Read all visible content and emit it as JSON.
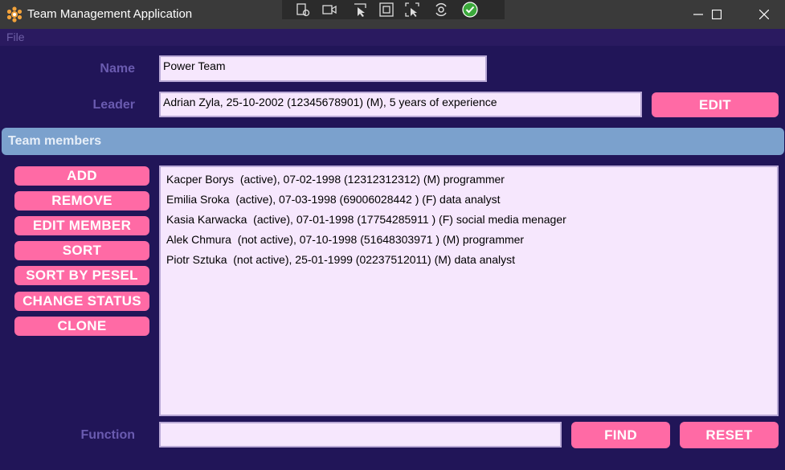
{
  "window": {
    "title": "Team Management Application"
  },
  "menu": {
    "file": "File"
  },
  "form": {
    "name_label": "Name",
    "name_value": "Power Team",
    "leader_label": "Leader",
    "leader_value": "Adrian Zyla, 25-10-2002 (12345678901) (M), 5 years of experience",
    "edit_button": "EDIT"
  },
  "section": {
    "title": "Team members"
  },
  "actions": {
    "add": "ADD",
    "remove": "REMOVE",
    "edit_member": "EDIT MEMBER",
    "sort": "SORT",
    "sort_by_pesel": "SORT BY PESEL",
    "change_status": "CHANGE STATUS",
    "clone": "CLONE"
  },
  "members": [
    "Kacper Borys  (active), 07-02-1998 (12312312312) (M) programmer",
    "Emilia Sroka  (active), 07-03-1998 (69006028442 ) (F) data analyst",
    "Kasia Karwacka  (active), 07-01-1998 (17754285911 ) (F) social media menager",
    "Alek Chmura  (not active), 07-10-1998 (51648303971 ) (M) programmer",
    "Piotr Sztuka  (not active), 25-01-1999 (02237512011) (M) data analyst"
  ],
  "search": {
    "function_label": "Function",
    "function_value": "",
    "find_button": "FIND",
    "reset_button": "RESET"
  },
  "colors": {
    "background": "#211558",
    "accent_button": "#ff6aa5",
    "section_header": "#7ba1cd",
    "field_background": "#f6e7fd"
  },
  "icons": {
    "app": "app-logo-icon",
    "debug_toolbar": [
      "select-element-icon",
      "record-icon",
      "pointer-select-icon",
      "bounds-icon",
      "track-focus-icon",
      "hot-reload-icon",
      "check-icon"
    ],
    "window_controls": [
      "minimize-icon",
      "maximize-icon",
      "close-icon"
    ]
  }
}
